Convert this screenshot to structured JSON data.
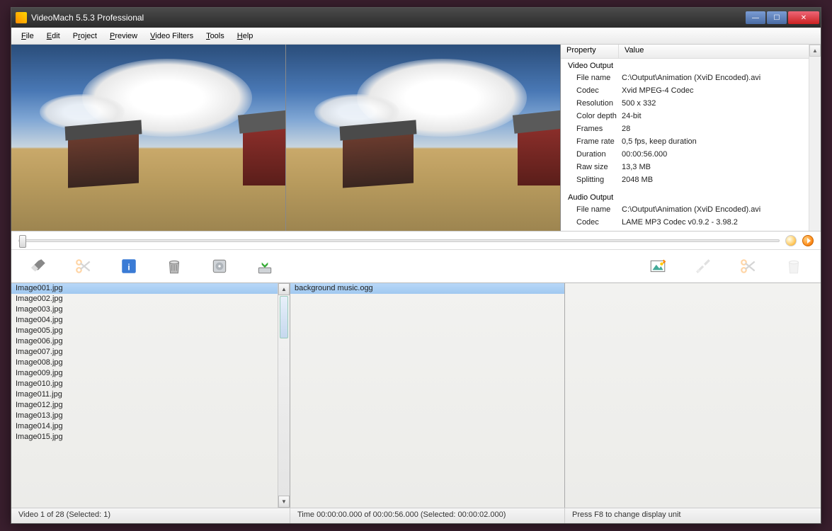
{
  "window": {
    "title": "VideoMach 5.5.3 Professional"
  },
  "menu": [
    "File",
    "Edit",
    "Project",
    "Preview",
    "Video Filters",
    "Tools",
    "Help"
  ],
  "properties": {
    "header": {
      "c1": "Property",
      "c2": "Value"
    },
    "sections": [
      {
        "title": "Video Output",
        "rows": [
          {
            "k": "File name",
            "v": "C:\\Output\\Animation (XviD Encoded).avi"
          },
          {
            "k": "Codec",
            "v": "Xvid MPEG-4 Codec"
          },
          {
            "k": "Resolution",
            "v": "500 x 332"
          },
          {
            "k": "Color depth",
            "v": "24-bit"
          },
          {
            "k": "Frames",
            "v": "28"
          },
          {
            "k": "Frame rate",
            "v": "0,5 fps, keep duration"
          },
          {
            "k": "Duration",
            "v": "00:00:56.000"
          },
          {
            "k": "Raw size",
            "v": "13,3 MB"
          },
          {
            "k": "Splitting",
            "v": "2048 MB"
          }
        ]
      },
      {
        "title": "Audio Output",
        "rows": [
          {
            "k": "File name",
            "v": "C:\\Output\\Animation (XviD Encoded).avi"
          },
          {
            "k": "Codec",
            "v": "LAME MP3 Codec v0.9.2 - 3.98.2"
          }
        ]
      }
    ]
  },
  "image_list": [
    "Image001.jpg",
    "Image002.jpg",
    "Image003.jpg",
    "Image004.jpg",
    "Image005.jpg",
    "Image006.jpg",
    "Image007.jpg",
    "Image008.jpg",
    "Image009.jpg",
    "Image010.jpg",
    "Image011.jpg",
    "Image012.jpg",
    "Image013.jpg",
    "Image014.jpg",
    "Image015.jpg"
  ],
  "audio_list": [
    "background music.ogg"
  ],
  "status": {
    "left": "Video 1 of 28  (Selected: 1)",
    "mid": "Time 00:00:00.000 of 00:00:56.000  (Selected: 00:00:02.000)",
    "right": "Press F8 to change display unit"
  },
  "icons": {
    "eraser": "eraser",
    "scissors": "scissors",
    "info": "info",
    "trash": "trash",
    "disk": "disk",
    "down": "download",
    "picture": "picture",
    "tools": "tools"
  }
}
